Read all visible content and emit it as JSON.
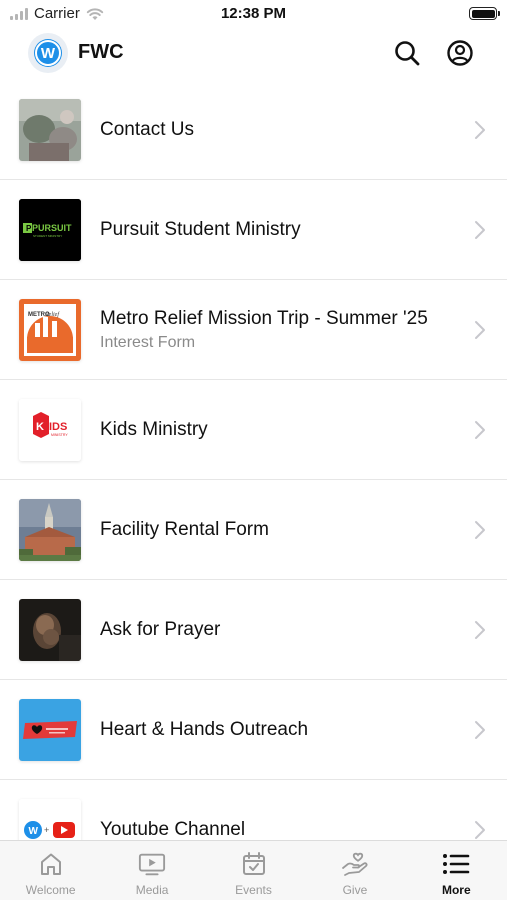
{
  "status_bar": {
    "carrier": "Carrier",
    "time": "12:38 PM",
    "icons": [
      "signal-icon",
      "wifi-icon",
      "battery-icon"
    ]
  },
  "header": {
    "logo_letter": "W",
    "title": "FWC",
    "icons": [
      "search-icon",
      "account-icon"
    ]
  },
  "list": {
    "items": [
      {
        "title": "Contact Us",
        "subtitle": "",
        "thumb": "contact-us-thumbnail"
      },
      {
        "title": "Pursuit Student Ministry",
        "subtitle": "",
        "thumb": "pursuit-logo-thumbnail",
        "thumb_text": "PURSUIT",
        "thumb_subtext": "STUDENT MINISTRY"
      },
      {
        "title": "Metro Relief Mission Trip - Summer '25",
        "subtitle": "Interest Form",
        "thumb": "metro-relief-logo-thumbnail",
        "thumb_text": "METRO",
        "thumb_subtext": "Relief"
      },
      {
        "title": "Kids Ministry",
        "subtitle": "",
        "thumb": "kids-ministry-logo-thumbnail",
        "thumb_text": "KIDS",
        "thumb_subtext": "MINISTRY"
      },
      {
        "title": "Facility Rental Form",
        "subtitle": "",
        "thumb": "church-building-thumbnail"
      },
      {
        "title": "Ask for Prayer",
        "subtitle": "",
        "thumb": "praying-hands-thumbnail"
      },
      {
        "title": "Heart & Hands Outreach",
        "subtitle": "",
        "thumb": "heart-hands-logo-thumbnail"
      },
      {
        "title": "Youtube Channel",
        "subtitle": "",
        "thumb": "youtube-channel-thumbnail"
      }
    ]
  },
  "tabbar": {
    "tabs": [
      {
        "label": "Welcome",
        "icon": "home-icon",
        "active": false
      },
      {
        "label": "Media",
        "icon": "tv-icon",
        "active": false
      },
      {
        "label": "Events",
        "icon": "calendar-icon",
        "active": false
      },
      {
        "label": "Give",
        "icon": "give-hand-heart-icon",
        "active": false
      },
      {
        "label": "More",
        "icon": "list-icon",
        "active": true
      }
    ]
  },
  "colors": {
    "brand_blue": "#1d8fe8",
    "text_primary": "#111111",
    "text_secondary": "#8a8a8a",
    "divider": "#e6e6e6",
    "tab_inactive": "#9a9a9a"
  }
}
